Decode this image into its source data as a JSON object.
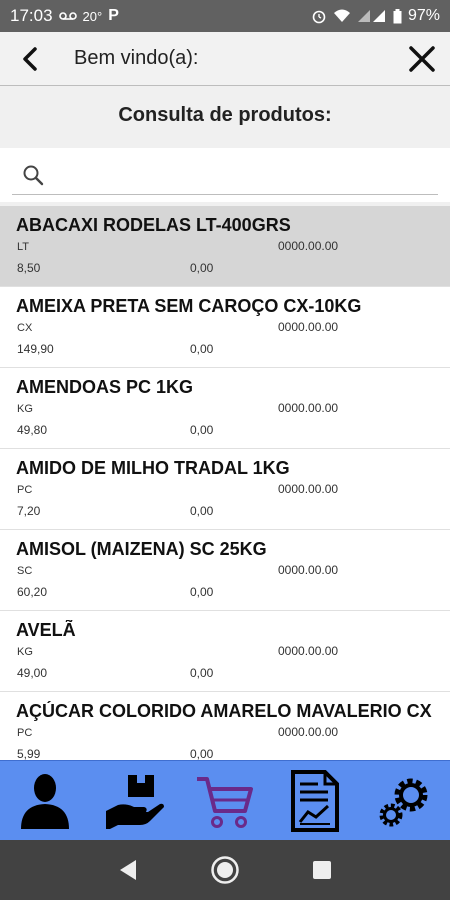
{
  "status_bar": {
    "time": "17:03",
    "temperature": "20°",
    "battery": "97%"
  },
  "header": {
    "title": "Bem vindo(a):"
  },
  "page": {
    "title": "Consulta de produtos:"
  },
  "search": {
    "placeholder": "",
    "value": ""
  },
  "products": [
    {
      "name": "ABACAXI RODELAS LT-400GRS",
      "unit": "LT",
      "code": "0000.00.00",
      "price": "8,50",
      "stock": "0,00",
      "selected": true
    },
    {
      "name": "AMEIXA PRETA SEM CAROÇO CX-10KG",
      "unit": "CX",
      "code": "0000.00.00",
      "price": "149,90",
      "stock": "0,00"
    },
    {
      "name": "AMENDOAS PC 1KG",
      "unit": "KG",
      "code": "0000.00.00",
      "price": "49,80",
      "stock": "0,00"
    },
    {
      "name": "AMIDO DE MILHO TRADAL 1KG",
      "unit": "PC",
      "code": "0000.00.00",
      "price": "7,20",
      "stock": "0,00"
    },
    {
      "name": "AMISOL (MAIZENA) SC 25KG",
      "unit": "SC",
      "code": "0000.00.00",
      "price": "60,20",
      "stock": "0,00"
    },
    {
      "name": "AVELÃ",
      "unit": "KG",
      "code": "0000.00.00",
      "price": "49,00",
      "stock": "0,00"
    },
    {
      "name": "AÇÚCAR COLORIDO AMARELO MAVALERIO CX",
      "unit": "PC",
      "code": "0000.00.00",
      "price": "5,99",
      "stock": "0,00"
    }
  ],
  "bottom_nav": [
    {
      "icon": "user-icon"
    },
    {
      "icon": "delivery-icon"
    },
    {
      "icon": "cart-icon"
    },
    {
      "icon": "report-icon"
    },
    {
      "icon": "settings-icon"
    }
  ],
  "colors": {
    "nav_bg": "#5b8ef0",
    "selected_row": "#d6d6d6",
    "cart_accent": "#6a2a8a"
  }
}
